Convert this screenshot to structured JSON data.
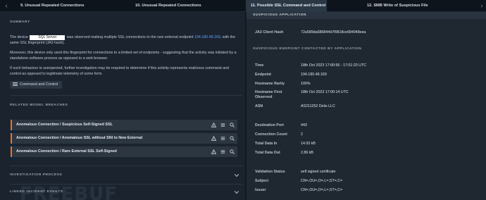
{
  "tabs": [
    {
      "label": "9. Unusual Repeated Connections"
    },
    {
      "label": "10. Unusual Repeated Connections"
    },
    {
      "label": "11. Possible SSL Command and Control"
    },
    {
      "label": "12. SMB Write of Suspicious File"
    }
  ],
  "left": {
    "summary_title": "SUMMARY",
    "summary_p1_a": "The device",
    "device_name": "SQL Server",
    "summary_p1_b": "was observed making multiple SSL connections to the rare external endpoint",
    "endpoint_ip": "194.180.48.169",
    "summary_p1_c": ", with the same SSL fingerprint (JA3 hash).",
    "summary_p2": "Moreover, this device only used this fingerprint for connections to a limited set of endpoints - suggesting that the activity was initiated by a standalone software process as opposed to a web browser.",
    "summary_p3": "If such behaviour is unexpected, further investigation may be required to determine if this activity represents malicious command and control as opposed to legitimate telemetry of some form.",
    "tag_label": "Command and Control",
    "related_title": "RELATED MODEL BREACHES",
    "breaches": [
      "Anomalous Connection / Suspicious Self-Signed SSL",
      "Anomalous Connection / Anomalous SSL without SNI to New External",
      "Anomalous Connection / Rare External SSL Self-Signed"
    ],
    "investigation_title": "INVESTIGATION PROCESS",
    "linked_title": "LINKED INCIDENT EVENTS",
    "watermark": "FREEBUF"
  },
  "right": {
    "app_title": "SUSPICIOUS APPLICATION",
    "ja3_label": "JA3 Client Hash",
    "ja3_value": "72a589da586844d7f0818ce684948eea",
    "endpoint_title": "SUSPICIOUS ENDPOINT CONTACTED BY APPLICATION",
    "fields": [
      {
        "label": "Time",
        "value": "18th Oct 2023 17:00:56 - 17:01:20 UTC"
      },
      {
        "label": "Endpoint",
        "value": "194.180.48.169"
      },
      {
        "label": "Hostname Rarity",
        "value": "100%"
      },
      {
        "label": "Hostname First Observed",
        "value": "18th Oct 2023 17:00:14 UTC"
      },
      {
        "label": "ASN",
        "value": "AS211252 Delis LLC"
      },
      {
        "label": "Destination Port",
        "value": "443"
      },
      {
        "label": "Connection Count",
        "value": "2"
      },
      {
        "label": "Total Data In",
        "value": "14.93 kB"
      },
      {
        "label": "Total Data Out",
        "value": "2.86 kB"
      },
      {
        "label": "Validation Status",
        "value": "self signed certificate"
      },
      {
        "label": "Subject",
        "value": "CN=,OU=,O=,L=,ST=,C="
      },
      {
        "label": "Issuer",
        "value": "CN=,OU=,O=,L=,ST=,C="
      }
    ]
  },
  "colors": {
    "accent_orange": "#e8742c",
    "link_blue": "#5aa3ff",
    "active_tab": "#2a3744"
  }
}
